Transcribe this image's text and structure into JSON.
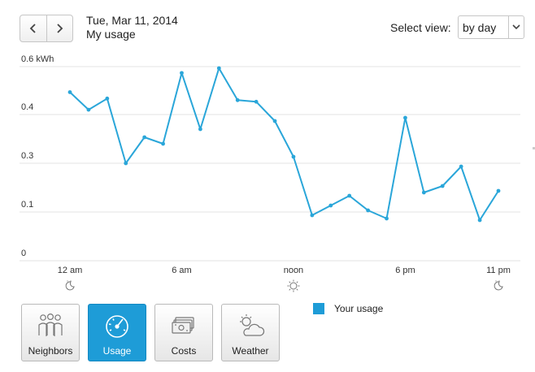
{
  "colors": {
    "accent": "#1e9cd7",
    "series": "#2aa6d9",
    "grid": "#e3e3e3"
  },
  "nav": {
    "prev_icon": "chevron-left-icon",
    "next_icon": "chevron-right-icon"
  },
  "header": {
    "date": "Tue, Mar 11, 2014",
    "subtitle": "My usage"
  },
  "view_select": {
    "label": "Select view:",
    "value": "by day"
  },
  "chart_data": {
    "type": "line",
    "ylabel": "kWh",
    "y_tick_labels": [
      "0.6 kWh",
      "0.4",
      "0.3",
      "0.1",
      "0"
    ],
    "y_tick_values": [
      0.6,
      0.45,
      0.3,
      0.15,
      0
    ],
    "ylim": [
      0,
      0.6
    ],
    "x_tick_labels": [
      "12 am",
      "6 am",
      "noon",
      "6 pm",
      "11 pm"
    ],
    "x_tick_hours": [
      0,
      6,
      12,
      18,
      23
    ],
    "x": [
      0,
      1,
      2,
      3,
      4,
      5,
      6,
      7,
      8,
      9,
      10,
      11,
      12,
      13,
      14,
      15,
      16,
      17,
      18,
      19,
      20,
      21,
      22,
      23
    ],
    "series": [
      {
        "name": "Your usage",
        "values": [
          0.52,
          0.465,
          0.5,
          0.3,
          0.38,
          0.36,
          0.58,
          0.405,
          0.595,
          0.495,
          0.49,
          0.43,
          0.32,
          0.14,
          0.17,
          0.2,
          0.155,
          0.13,
          0.44,
          0.21,
          0.23,
          0.29,
          0.125,
          0.215
        ]
      }
    ],
    "grid": true,
    "x_tick_icons": [
      "moon-icon",
      "",
      "sun-icon",
      "",
      "moon-icon"
    ],
    "legend_position": "bottom-right"
  },
  "legend": {
    "label": "Your usage"
  },
  "categories": [
    {
      "label": "Neighbors",
      "icon": "people-icon",
      "active": false
    },
    {
      "label": "Usage",
      "icon": "gauge-icon",
      "active": true
    },
    {
      "label": "Costs",
      "icon": "money-icon",
      "active": false
    },
    {
      "label": "Weather",
      "icon": "weather-icon",
      "active": false
    }
  ]
}
